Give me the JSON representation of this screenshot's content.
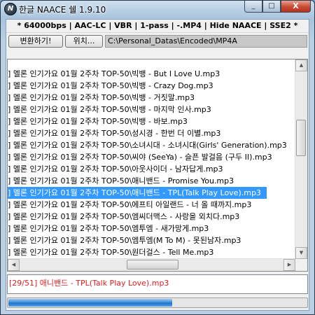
{
  "window": {
    "title": "한글 NAACE 쉘 1.9.10",
    "icon_letter": "N",
    "controls": {
      "minimize": "_",
      "maximize": "□",
      "close": "X"
    }
  },
  "options": {
    "text": "* 64000bps | AAC-LC | VBR | 1-pass | -.MP4 | Hide NAACE | SSE2 *"
  },
  "toolbar": {
    "convert_label": "변환하기!",
    "locate_label": "위치...",
    "output_path": "C:\\Personal_Datas\\Encoded\\MP4A"
  },
  "file_list": {
    "items": [
      "] 멜론 인기가요 01월 2주차 TOP-50\\빅뱅 - But I Love U.mp3",
      "] 멜론 인기가요 01월 2주차 TOP-50\\빅뱅 - Crazy Dog.mp3",
      "] 멜론 인기가요 01월 2주차 TOP-50\\빅뱅 - 거짓말.mp3",
      "] 멜론 인기가요 01월 2주차 TOP-50\\빅뱅 - 마지막 인사.mp3",
      "] 멜론 인기가요 01월 2주차 TOP-50\\빅뱅 - 바보.mp3",
      "] 멜론 인기가요 01월 2주차 TOP-50\\성시경 - 한번 더 이별.mp3",
      "] 멜론 인기가요 01월 2주차 TOP-50\\소녀시대 - 소녀시대(Girls' Generation).mp3",
      "] 멜론 인기가요 01월 2주차 TOP-50\\씨야 (SeeYa) - 슬픈 발걸음 (구두 II).mp3",
      "] 멜론 인기가요 01월 2주차 TOP-50\\아웃사이더 - 남자답게.mp3",
      "] 멜론 인기가요 01월 2주차 TOP-50\\애니밴드 - Promise You.mp3",
      "] 멜론 인기가요 01월 2주차 TOP-50\\애니밴드 - TPL(Talk Play Love).mp3",
      "] 멜론 인기가요 01월 2주차 TOP-50\\에프티 아일랜드 - 너 올 때까지.mp3",
      "] 멜론 인기가요 01월 2주차 TOP-50\\엠씨더맥스 - 사랑을 외치다.mp3",
      "] 멜론 인기가요 01월 2주차 TOP-50\\엠투엠 - 새가망게.mp3",
      "] 멜론 인기가요 01월 2주차 TOP-50\\엠투엠(M To M) - 못된남자.mp3",
      "] 멜론 인기가요 01월 2주차 TOP-50\\원더걸스 - Tell Me.mp3"
    ],
    "selected_index": 10
  },
  "scrollbar_glyphs": {
    "up": "▲",
    "down": "▼",
    "left": "◀",
    "right": "▶"
  },
  "status": {
    "text": "[29/51] 애니밴드 - TPL(Talk Play Love).mp3",
    "color": "#e02020"
  },
  "progress": {
    "fraction": 0.55,
    "color": "#3e8ede"
  }
}
